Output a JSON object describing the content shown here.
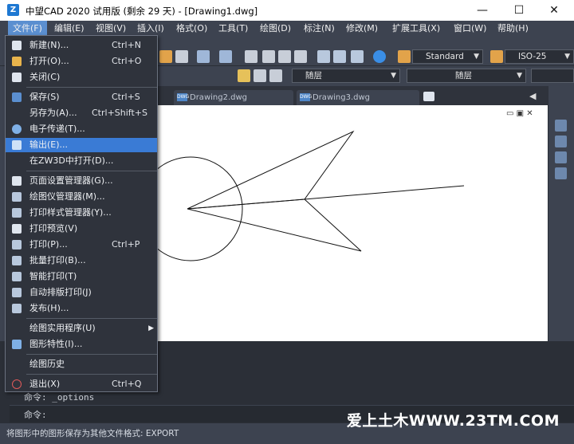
{
  "titlebar": {
    "logo": "Z",
    "title": "中望CAD 2020 试用版 (剩余 29 天) - [Drawing1.dwg]",
    "minimize": "—",
    "maximize": "☐",
    "close": "✕"
  },
  "menubar": {
    "items": [
      "文件(F)",
      "编辑(E)",
      "视图(V)",
      "插入(I)",
      "格式(O)",
      "工具(T)",
      "绘图(D)",
      "标注(N)",
      "修改(M)",
      "扩展工具(X)",
      "窗口(W)",
      "帮助(H)"
    ]
  },
  "toolbar": {
    "text_style": "Standard",
    "dim_style": "ISO-25",
    "layer": "随层",
    "linetype": "随层"
  },
  "tabs": [
    {
      "label": "Drawing2.dwg"
    },
    {
      "label": "Drawing3.dwg"
    }
  ],
  "file_menu": {
    "items": [
      {
        "label": "新建(N)...",
        "shortcut": "Ctrl+N",
        "icon": "new-file-icon"
      },
      {
        "label": "打开(O)...",
        "shortcut": "Ctrl+O",
        "icon": "open-folder-icon"
      },
      {
        "label": "关闭(C)",
        "shortcut": "",
        "icon": "close-doc-icon"
      },
      {
        "label": "保存(S)",
        "shortcut": "Ctrl+S",
        "icon": "save-icon"
      },
      {
        "label": "另存为(A)...",
        "shortcut": "Ctrl+Shift+S",
        "icon": ""
      },
      {
        "label": "电子传递(T)...",
        "shortcut": "",
        "icon": "etransmit-icon"
      },
      {
        "label": "输出(E)...",
        "shortcut": "",
        "icon": "export-icon"
      },
      {
        "label": "在ZW3D中打开(D)...",
        "shortcut": "",
        "icon": ""
      },
      {
        "label": "页面设置管理器(G)...",
        "shortcut": "",
        "icon": "page-setup-icon"
      },
      {
        "label": "绘图仪管理器(M)...",
        "shortcut": "",
        "icon": "plotter-icon"
      },
      {
        "label": "打印样式管理器(Y)...",
        "shortcut": "",
        "icon": "plot-style-icon"
      },
      {
        "label": "打印预览(V)",
        "shortcut": "",
        "icon": "preview-icon"
      },
      {
        "label": "打印(P)...",
        "shortcut": "Ctrl+P",
        "icon": "print-icon"
      },
      {
        "label": "批量打印(B)...",
        "shortcut": "",
        "icon": "batch-print-icon"
      },
      {
        "label": "智能打印(T)",
        "shortcut": "",
        "icon": "smart-print-icon"
      },
      {
        "label": "自动排版打印(J)",
        "shortcut": "",
        "icon": "auto-layout-print-icon"
      },
      {
        "label": "发布(H)...",
        "shortcut": "",
        "icon": "publish-icon"
      },
      {
        "label": "绘图实用程序(U)",
        "shortcut": "",
        "icon": ""
      },
      {
        "label": "图形特性(I)...",
        "shortcut": "",
        "icon": "properties-icon"
      },
      {
        "label": "绘图历史",
        "shortcut": "",
        "icon": ""
      },
      {
        "label": "退出(X)",
        "shortcut": "Ctrl+Q",
        "icon": "exit-icon"
      }
    ]
  },
  "command": {
    "history_line": "命令: _options",
    "prompt": "命令:"
  },
  "status": {
    "text": "将图形中的图形保存为其他文件格式: EXPORT"
  },
  "watermark": "爱上土木WWW.23TM.COM"
}
